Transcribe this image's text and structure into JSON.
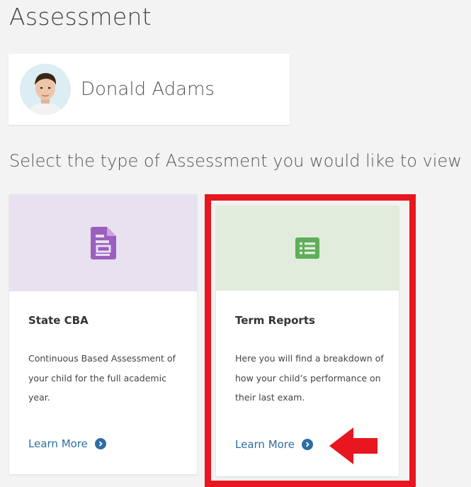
{
  "page": {
    "title": "Assessment",
    "prompt": "Select the type of Assessment you would like to view"
  },
  "student": {
    "name": "Donald Adams",
    "avatar_icon": "student-photo"
  },
  "cards": [
    {
      "title": "State CBA",
      "description": "Continuous Based Assessment of your child for the full academic year.",
      "link_label": "Learn More",
      "icon": "document-icon",
      "hero_color": "#e8e1ef",
      "icon_color": "#9a5fbf"
    },
    {
      "title": "Term Reports",
      "description": "Here you will find a breakdown of how your child’s performance on their last exam.",
      "link_label": "Learn More",
      "icon": "list-icon",
      "hero_color": "#e1ecdd",
      "icon_color": "#5fae5a"
    }
  ],
  "annotation": {
    "highlight_color": "#e8161e",
    "arrow_icon": "red-left-arrow"
  },
  "colors": {
    "link": "#2e6da4",
    "background": "#f3f3f3"
  }
}
